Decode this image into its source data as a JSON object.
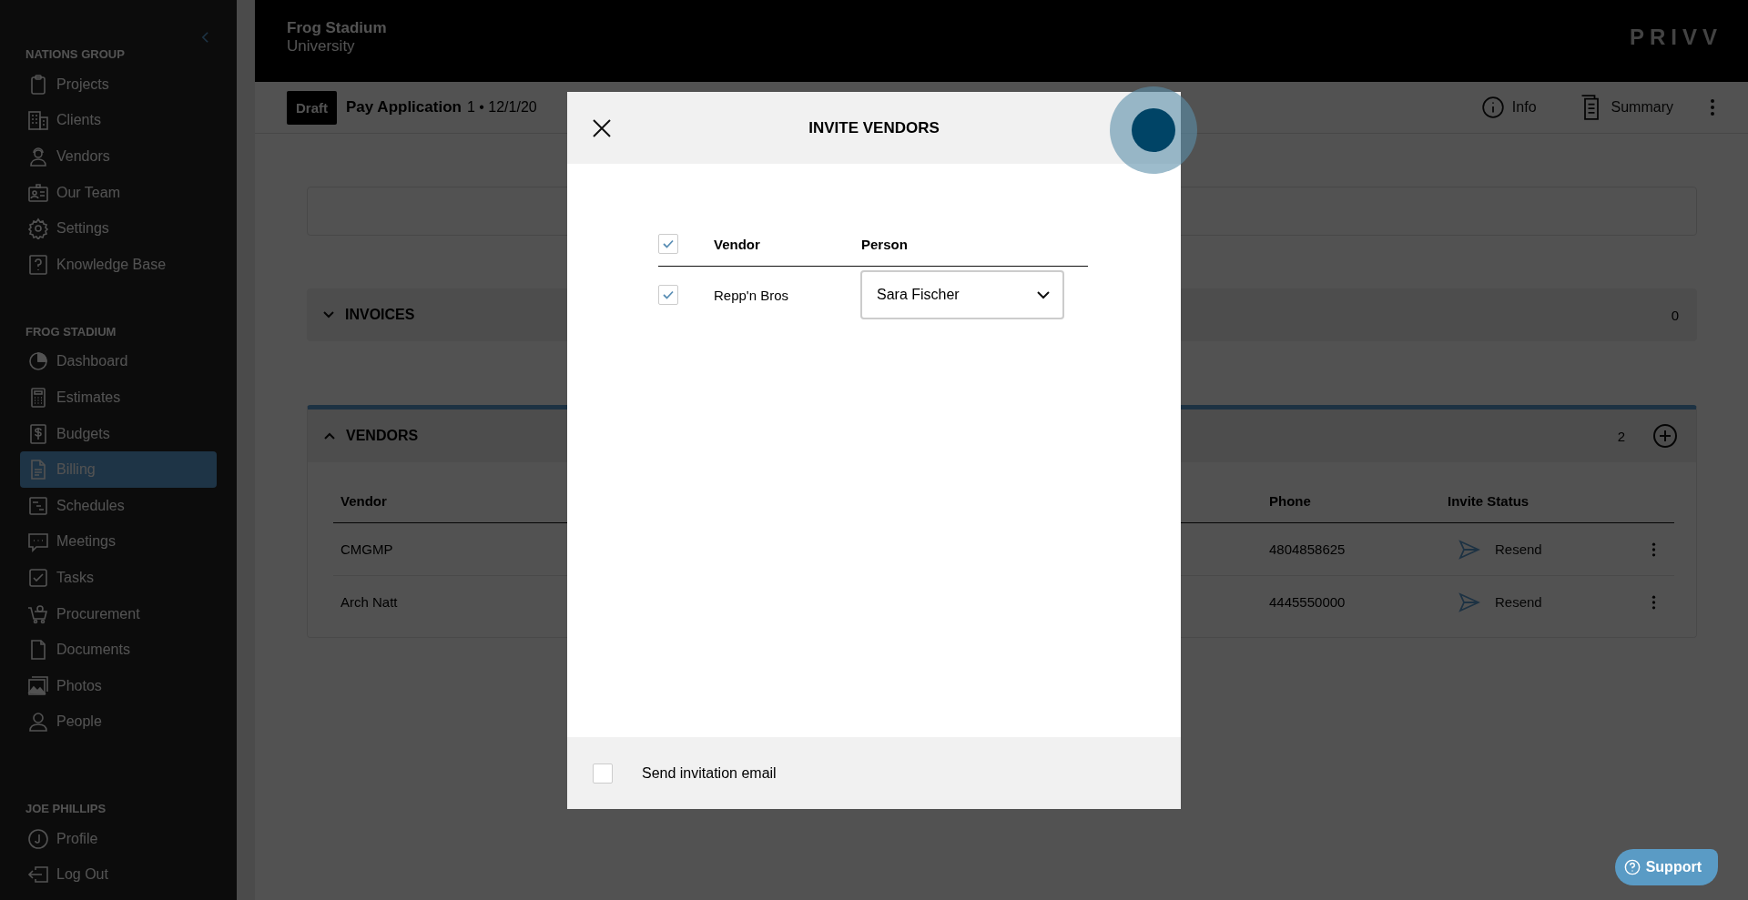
{
  "sidebar": {
    "sections": [
      {
        "heading": "NATIONS GROUP",
        "items": [
          {
            "label": "Projects",
            "selected": false
          },
          {
            "label": "Clients",
            "selected": false
          },
          {
            "label": "Vendors",
            "selected": false
          },
          {
            "label": "Our Team",
            "selected": false
          },
          {
            "label": "Settings",
            "selected": false
          },
          {
            "label": "Knowledge Base",
            "selected": false
          }
        ]
      },
      {
        "heading": "FROG STADIUM",
        "items": [
          {
            "label": "Dashboard",
            "selected": false
          },
          {
            "label": "Estimates",
            "selected": false
          },
          {
            "label": "Budgets",
            "selected": false
          },
          {
            "label": "Billing",
            "selected": true
          },
          {
            "label": "Schedules",
            "selected": false
          },
          {
            "label": "Meetings",
            "selected": false
          },
          {
            "label": "Tasks",
            "selected": false
          },
          {
            "label": "Procurement",
            "selected": false
          },
          {
            "label": "Documents",
            "selected": false
          },
          {
            "label": "Photos",
            "selected": false
          },
          {
            "label": "People",
            "selected": false
          }
        ]
      },
      {
        "heading": "JOE PHILLIPS",
        "items": [
          {
            "label": "Profile",
            "selected": false
          },
          {
            "label": "Log Out",
            "selected": false
          }
        ]
      }
    ]
  },
  "header": {
    "project": "Frog Stadium",
    "client": "University",
    "logo": "PRIVV"
  },
  "toolbar": {
    "status": "Draft",
    "title": "Pay Application",
    "subtitle": "1 • 12/1/20",
    "actions": [
      {
        "label": "Info"
      },
      {
        "label": "Summary"
      }
    ]
  },
  "invoices": {
    "title": "INVOICES",
    "count": "0",
    "expanded": false
  },
  "vendors": {
    "title": "VENDORS",
    "count": "2",
    "expanded": true,
    "columns": [
      "Vendor",
      "Phone",
      "Invite Status"
    ],
    "rows": [
      {
        "vendor": "CMGMP",
        "phone": "4804858625",
        "status": "Resend"
      },
      {
        "vendor": "Arch Natt",
        "phone": "4445550000",
        "status": "Resend"
      }
    ]
  },
  "modal": {
    "title": "INVITE VENDORS",
    "all_checked": true,
    "columns": [
      "Vendor",
      "Person"
    ],
    "rows": [
      {
        "vendor": "Repp'n Bros",
        "person": "Sara Fischer",
        "checked": true
      }
    ],
    "send_email": {
      "label": "Send invitation email",
      "checked": false
    }
  },
  "support": {
    "label": "Support"
  }
}
